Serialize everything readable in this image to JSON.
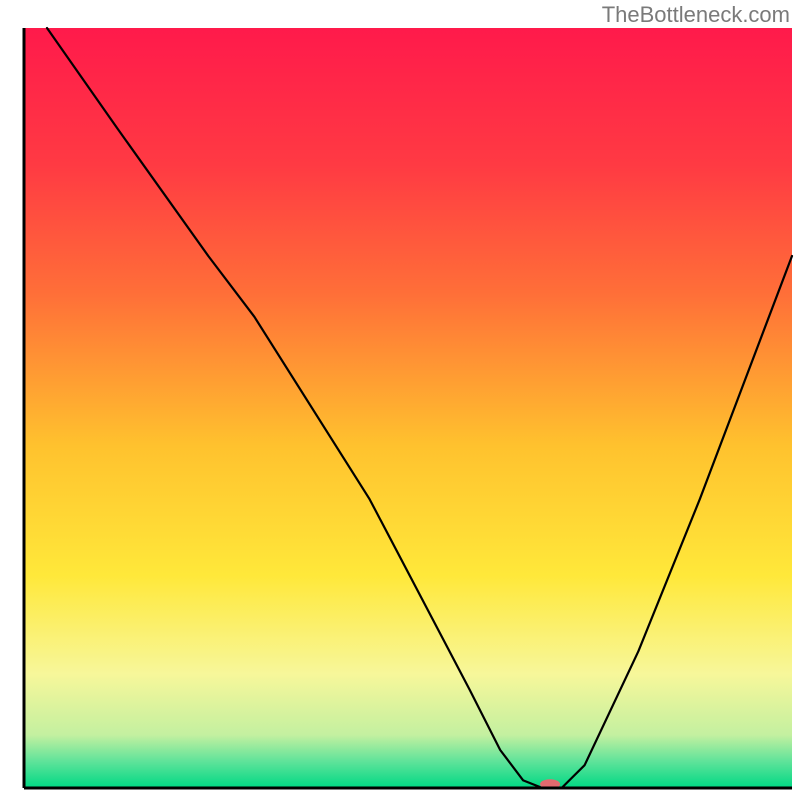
{
  "watermark": "TheBottleneck.com",
  "chart_data": {
    "type": "line",
    "title": "",
    "xlabel": "",
    "ylabel": "",
    "xlim": [
      0,
      100
    ],
    "ylim": [
      0,
      100
    ],
    "grid": false,
    "legend": false,
    "background_gradient_stops": [
      {
        "offset": 0.0,
        "color": "#ff1a4b"
      },
      {
        "offset": 0.18,
        "color": "#ff3a43"
      },
      {
        "offset": 0.35,
        "color": "#ff6f38"
      },
      {
        "offset": 0.55,
        "color": "#ffc22e"
      },
      {
        "offset": 0.72,
        "color": "#ffe83a"
      },
      {
        "offset": 0.85,
        "color": "#f7f79a"
      },
      {
        "offset": 0.93,
        "color": "#c4f0a0"
      },
      {
        "offset": 0.965,
        "color": "#5fe39a"
      },
      {
        "offset": 1.0,
        "color": "#00d884"
      }
    ],
    "series": [
      {
        "name": "bottleneck-curve",
        "x": [
          3,
          12,
          24,
          30,
          45,
          58,
          62,
          65,
          67.5,
          70,
          73,
          80,
          88,
          100
        ],
        "y": [
          100,
          87,
          70,
          62,
          38,
          13,
          5,
          1,
          0,
          0,
          3,
          18,
          38,
          70
        ]
      }
    ],
    "marker": {
      "name": "optimal-point",
      "x": 68.5,
      "y": 0.5,
      "color": "#e46a6f",
      "rx": 10,
      "ry": 5
    },
    "axes": {
      "left": {
        "x": 3,
        "y1": 3,
        "y2": 100
      },
      "bottom": {
        "y": 100,
        "x1": 3,
        "x2": 100
      }
    },
    "stroke": {
      "curve_color": "#000000",
      "curve_width": 2.2,
      "axis_color": "#000000",
      "axis_width": 3
    }
  }
}
